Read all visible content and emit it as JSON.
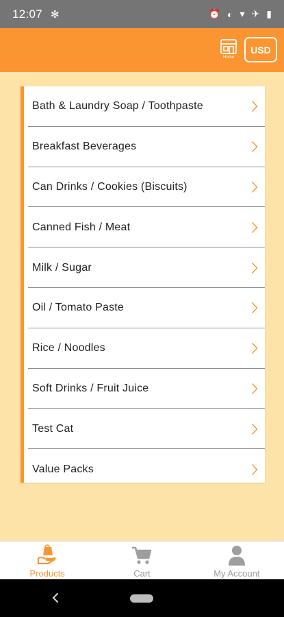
{
  "status_bar": {
    "time": "12:07",
    "icons": [
      "fan-icon",
      "alarm-icon",
      "data-saver-icon",
      "wifi-icon",
      "airplane-icon",
      "battery-icon"
    ]
  },
  "app_bar": {
    "home_label": "Home",
    "currency_label": "USD",
    "background_color": "#fb9531"
  },
  "categories": [
    "Bath & Laundry Soap / Toothpaste",
    "Breakfast Beverages",
    "Can Drinks / Cookies (Biscuits)",
    "Canned Fish / Meat",
    "Milk / Sugar",
    "Oil / Tomato Paste",
    "Rice / Noodles",
    "Soft Drinks / Fruit Juice",
    "Test Cat",
    "Value Packs"
  ],
  "bottom_nav": {
    "items": [
      {
        "label": "Products",
        "icon": "hand-bag-icon",
        "active": true
      },
      {
        "label": "Cart",
        "icon": "cart-icon",
        "active": false
      },
      {
        "label": "My Account",
        "icon": "person-icon",
        "active": false
      }
    ],
    "active_color": "#fb9531",
    "inactive_color": "#999999"
  }
}
